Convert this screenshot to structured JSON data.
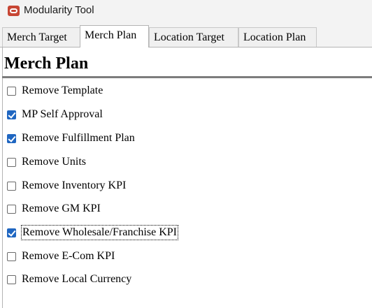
{
  "window": {
    "title": "Modularity Tool",
    "icon": "oracle-icon",
    "brand_color": "#c74634"
  },
  "tabs": [
    {
      "label": "Merch Target",
      "active": false
    },
    {
      "label": "Merch Plan",
      "active": true
    },
    {
      "label": "Location Target",
      "active": false
    },
    {
      "label": "Location Plan",
      "active": false
    }
  ],
  "panel": {
    "title": "Merch Plan",
    "options": [
      {
        "label": "Remove Template",
        "checked": false
      },
      {
        "label": "MP Self Approval",
        "checked": true
      },
      {
        "label": "Remove Fulfillment Plan",
        "checked": true
      },
      {
        "label": "Remove Units",
        "checked": false
      },
      {
        "label": "Remove Inventory KPI",
        "checked": false
      },
      {
        "label": "Remove GM KPI",
        "checked": false
      },
      {
        "label": "Remove Wholesale/Franchise KPI",
        "checked": true,
        "focused": true
      },
      {
        "label": "Remove E-Com KPI",
        "checked": false
      },
      {
        "label": "Remove Local Currency",
        "checked": false
      }
    ]
  },
  "colors": {
    "checkbox_checked": "#1f66c1"
  }
}
